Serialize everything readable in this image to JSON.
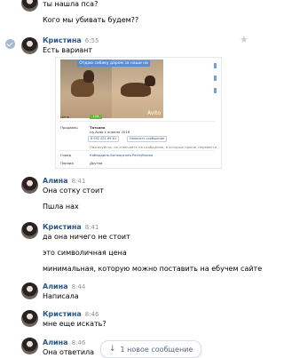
{
  "messages": [
    {
      "name": "",
      "time": "",
      "lines": [
        "ты нашла пса?",
        "Кого мы убивать будем??"
      ]
    },
    {
      "name": "Кристина",
      "time": "6:55",
      "lines": [
        "Есть вариант"
      ]
    },
    {
      "name": "Алина",
      "time": "8:41",
      "lines": [
        "Она сотку стоит",
        "Пшла нах"
      ]
    },
    {
      "name": "Кристина",
      "time": "8:41",
      "lines": [
        "да она ничего не стоит",
        "это символичная цена",
        "минимальная, которую можно поставить на ебучем сайте"
      ]
    },
    {
      "name": "Алина",
      "time": "8:44",
      "lines": [
        "Написала"
      ]
    },
    {
      "name": "Кристина",
      "time": "8:46",
      "lines": [
        "мне еще искать?"
      ]
    },
    {
      "name": "Алина",
      "time": "8:46",
      "lines": [
        "Она ответила"
      ]
    }
  ],
  "snippet": {
    "banner": "Отдаю собаку даром за наши на ВАЗ",
    "watermark": "Avito",
    "rows": [
      {
        "label": "Цена",
        "value": "100 руб."
      },
      {
        "label": "Продавец",
        "value": "Татьяна"
      },
      {
        "label": "",
        "value": "на Avito с апреля 2016"
      },
      {
        "label": "",
        "value": "8 952 451-69-61"
      },
      {
        "label": "",
        "value": "Написать сообщение"
      },
      {
        "label": "",
        "value": "Пожалуйста, не отвечайте на сообщения, в которых просят перевести..."
      },
      {
        "label": "Город",
        "value": "Кабардино-Балкарская Республика"
      },
      {
        "label": "Порода",
        "value": "Другая"
      }
    ]
  },
  "new_messages": {
    "label": "1 новое сообщение",
    "icon": "arrow-down-icon"
  },
  "colors": {
    "name": "#2a5885",
    "time": "#939393",
    "accent": "#5e8bd0",
    "price_badge": "#6cb342"
  }
}
